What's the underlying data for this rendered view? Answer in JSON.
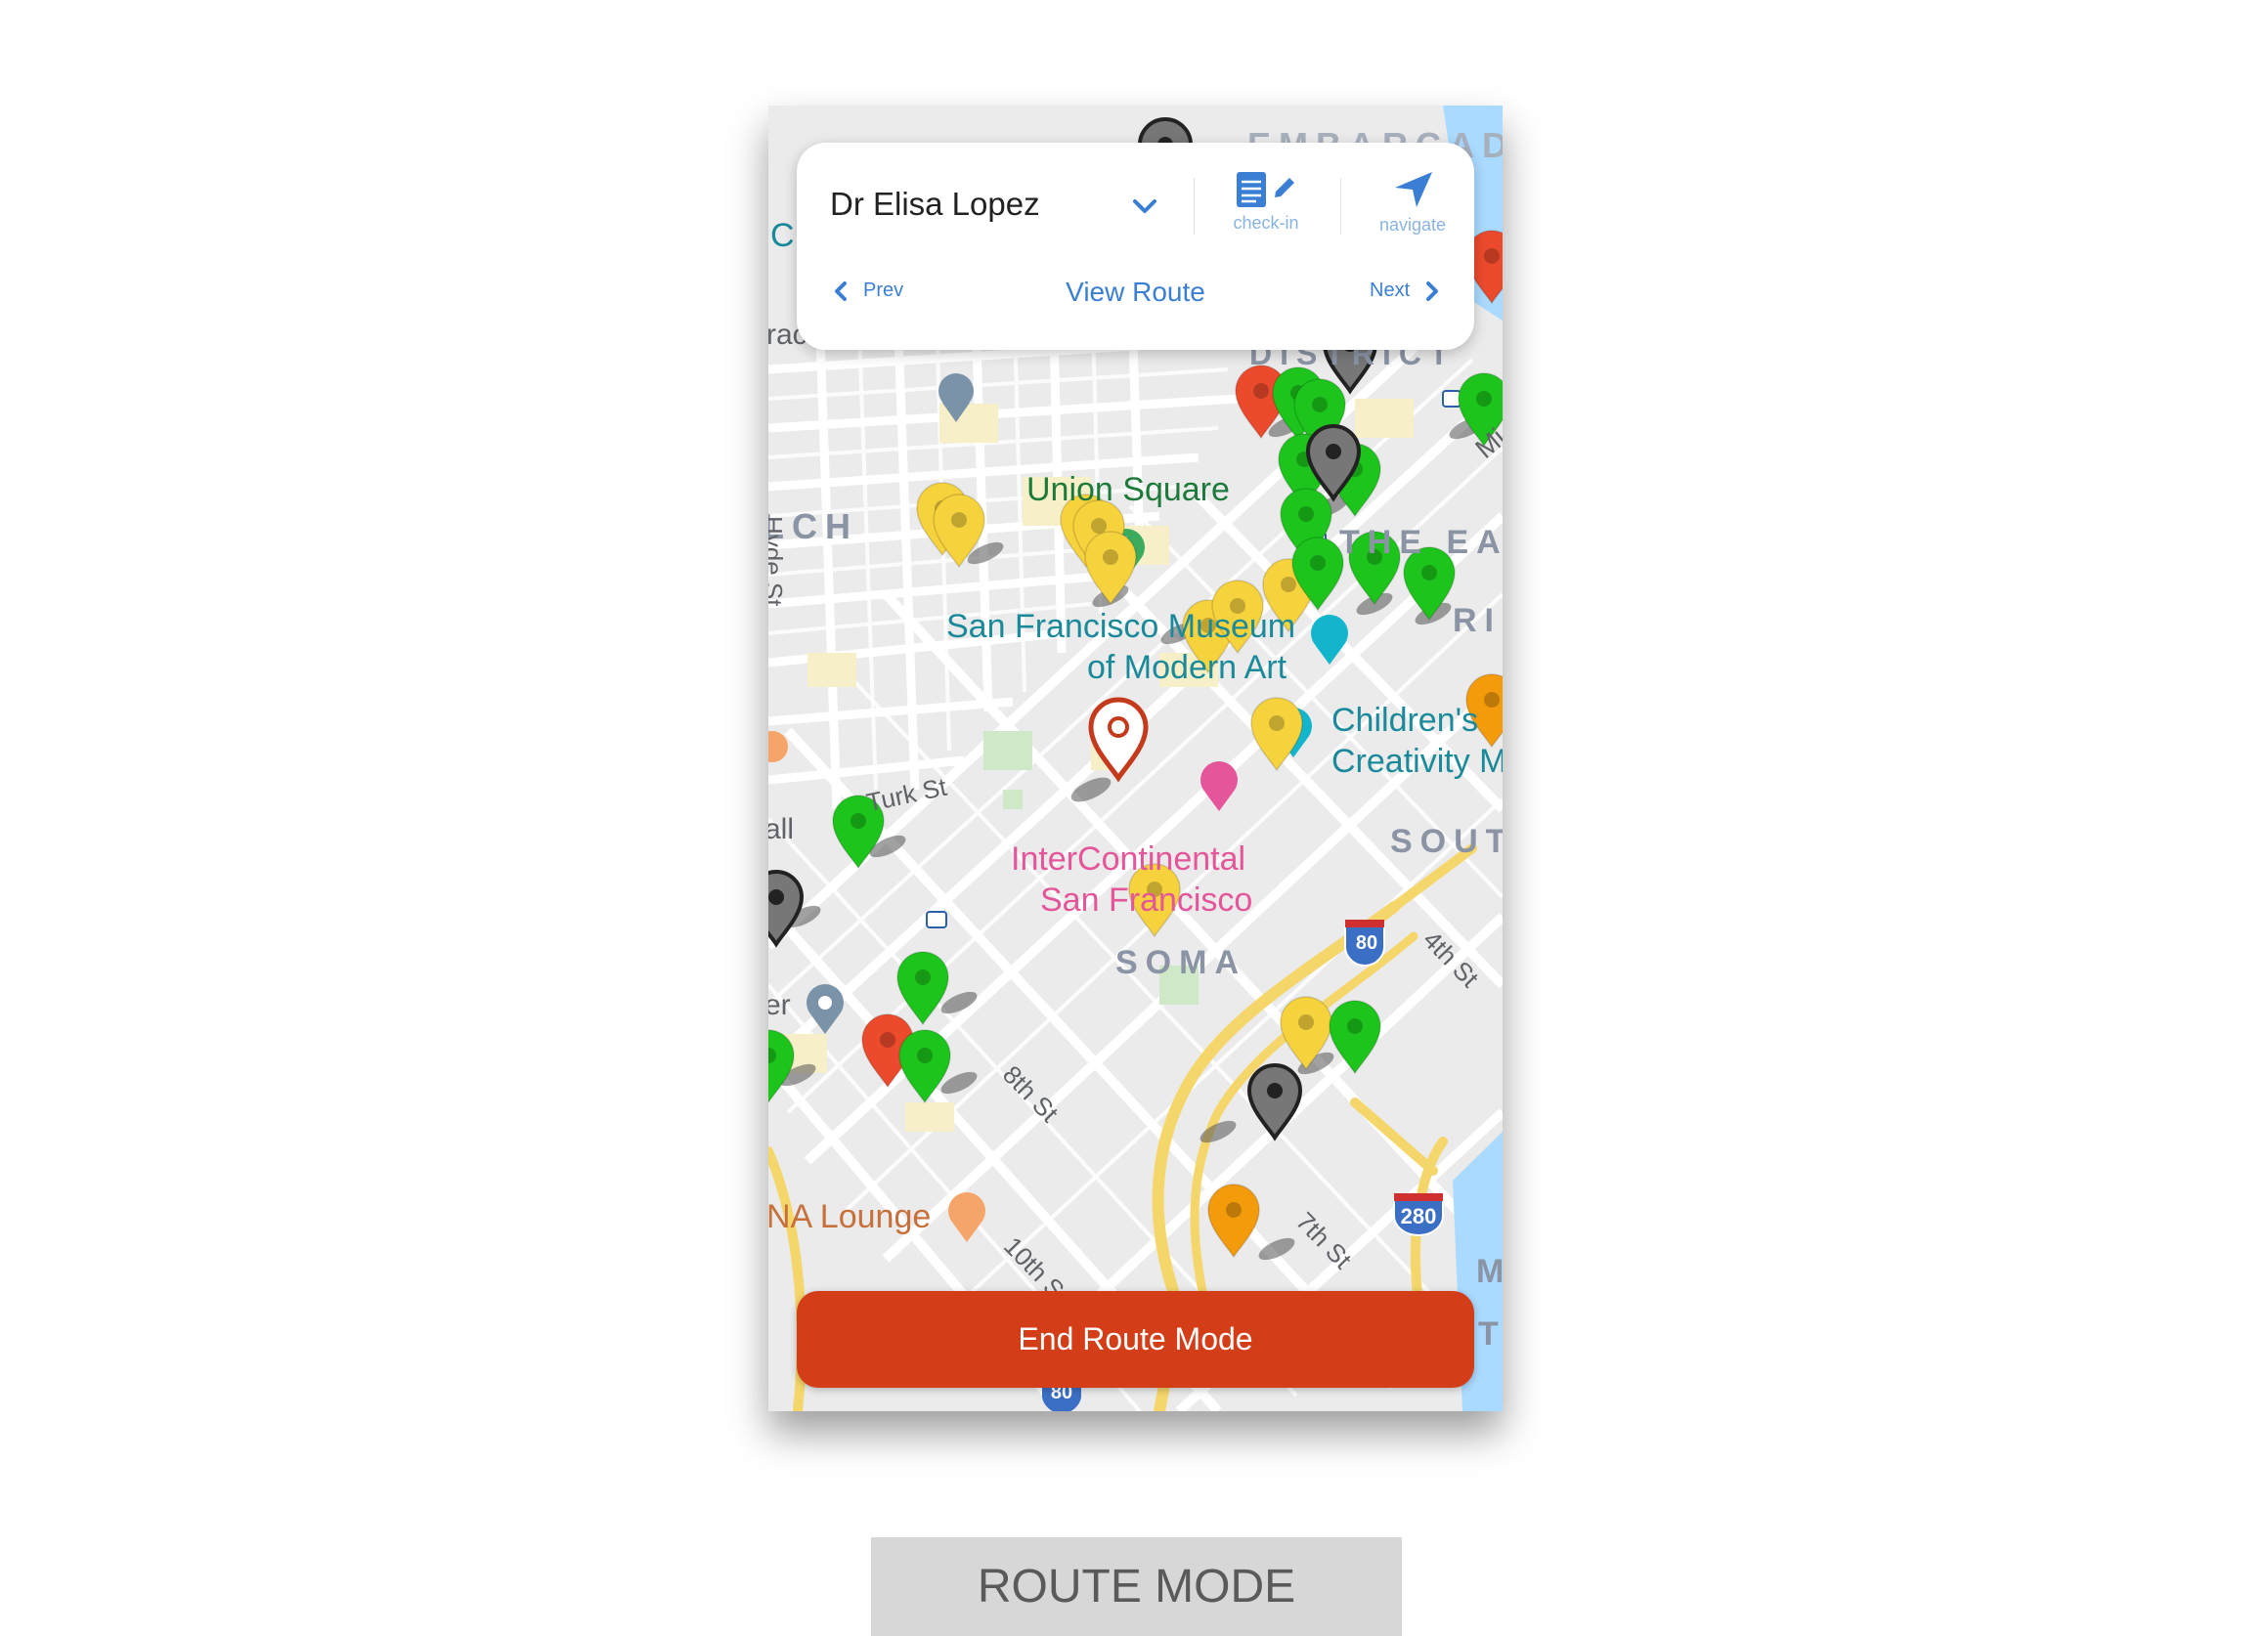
{
  "screen": {
    "owner_name": "Dr Elisa Lopez",
    "actions": {
      "checkin_label": "check-in",
      "navigate_label": "navigate"
    },
    "nav": {
      "prev_label": "Prev",
      "view_route_label": "View Route",
      "next_label": "Next"
    },
    "end_button_label": "End Route Mode"
  },
  "map": {
    "labels": {
      "embarcadero": "EMBARCAD",
      "district": "DISTRICT",
      "tenderloin_partial": "LCH",
      "east_cut": "THE EA",
      "ri": "RI",
      "soma": "SOMA",
      "south": "SOUT",
      "union_square": "Union Square",
      "sfmoma_1": "San Francisco Museum",
      "sfmoma_2": "of Modern Art",
      "childrens_1": "Children's",
      "childrens_2": "Creativity M",
      "intercontinental_1": "InterContinental",
      "intercontinental_2": "San Francisco",
      "na_lounge": "NA Lounge",
      "hyde_st": "Hyde St",
      "turk_st": "Turk St",
      "eighth_st": "8th St",
      "tenth_st": "10th S",
      "seventh_st": "7th St",
      "fourth_st": "4th St",
      "frag_c": "C",
      "frag_rac": "rac",
      "frag_all": "all",
      "frag_er": "er",
      "frag_mi": "Mi",
      "frag_m": "M",
      "frag_t": "T"
    },
    "shields": {
      "i80_top": "80",
      "i280": "280",
      "i80_bottom": "80"
    },
    "pin_colors": {
      "green": "#1cc41c",
      "yellow": "#f6d23d",
      "red": "#ec4a2c",
      "orange": "#f39b0b",
      "gray": "#777777",
      "selected": "#c43a1d"
    },
    "icons": [
      "chevron-down-icon",
      "document-edit-icon",
      "navigation-arrow-icon",
      "chevron-left-icon",
      "chevron-right-icon"
    ]
  },
  "caption": "ROUTE MODE"
}
